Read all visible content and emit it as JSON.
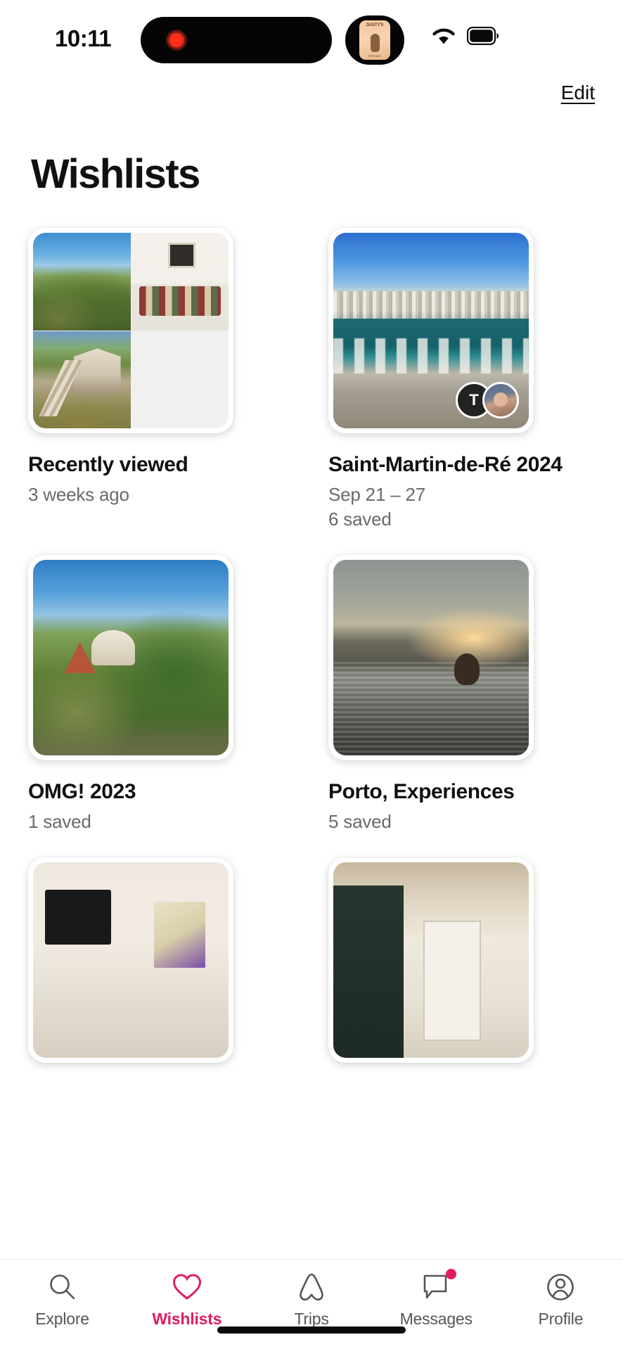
{
  "status_bar": {
    "time": "10:11",
    "recording_indicator": "record-dot",
    "live_activity_icon": "podcast-artwork",
    "podcast_title_top": "DUSTY'S",
    "podcast_title_mid": "PODCAST",
    "podcast_footer": "EPISODE",
    "wifi_icon": "wifi-icon",
    "battery_icon": "battery-icon"
  },
  "header": {
    "edit_label": "Edit",
    "title": "Wishlists"
  },
  "wishlists": [
    {
      "title": "Recently viewed",
      "subtitle": "3 weeks ago",
      "subtitle2": "",
      "thumb_type": "collage",
      "collage": [
        "ph-garden",
        "ph-bedroom",
        "ph-cabin",
        "empty"
      ],
      "avatars": []
    },
    {
      "title": "Saint-Martin-de-Ré 2024",
      "subtitle": "Sep 21 – 27",
      "subtitle2": "6 saved",
      "thumb_type": "single",
      "photo": "ph-marina",
      "avatars": [
        {
          "kind": "initial",
          "label": "T"
        },
        {
          "kind": "photo",
          "label": ""
        }
      ]
    },
    {
      "title": "OMG! 2023",
      "subtitle": "1 saved",
      "subtitle2": "",
      "thumb_type": "single",
      "photo": "ph-omg",
      "avatars": []
    },
    {
      "title": "Porto, Experiences",
      "subtitle": "5 saved",
      "subtitle2": "",
      "thumb_type": "single",
      "photo": "ph-lagoon",
      "avatars": []
    },
    {
      "title": "",
      "subtitle": "",
      "subtitle2": "",
      "thumb_type": "single",
      "photo": "ph-dining",
      "avatars": []
    },
    {
      "title": "",
      "subtitle": "",
      "subtitle2": "",
      "thumb_type": "single",
      "photo": "ph-hall",
      "avatars": []
    }
  ],
  "tabbar": {
    "active_color": "#E31C5F",
    "inactive_color": "#555555",
    "items": [
      {
        "label": "Explore",
        "icon": "search-icon",
        "active": false,
        "badge": false
      },
      {
        "label": "Wishlists",
        "icon": "heart-icon",
        "active": true,
        "badge": false
      },
      {
        "label": "Trips",
        "icon": "airbnb-belo-icon",
        "active": false,
        "badge": false
      },
      {
        "label": "Messages",
        "icon": "speech-bubble-icon",
        "active": false,
        "badge": true
      },
      {
        "label": "Profile",
        "icon": "person-circle-icon",
        "active": false,
        "badge": false
      }
    ]
  }
}
